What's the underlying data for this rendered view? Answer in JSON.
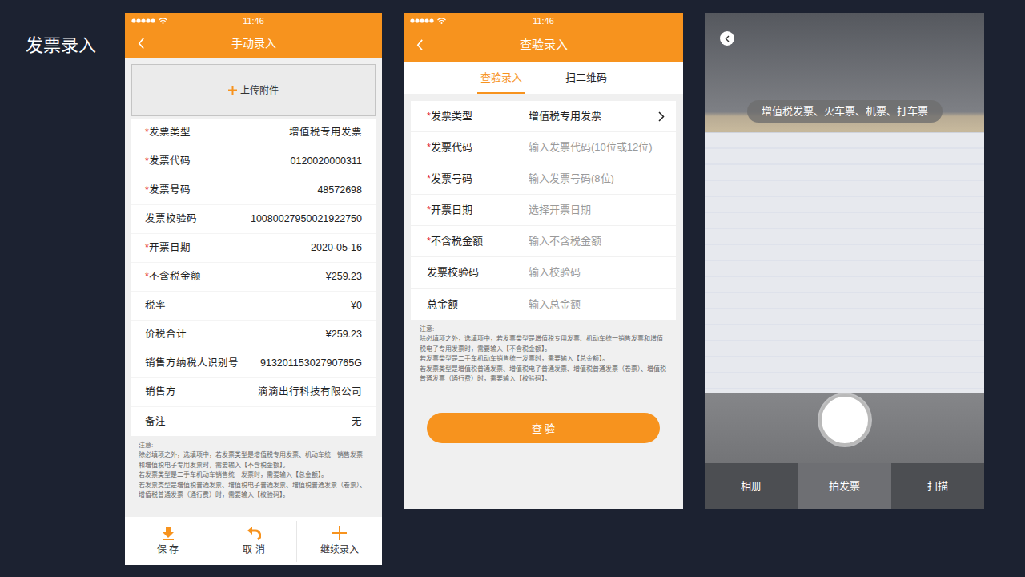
{
  "page": {
    "title": "发票录入"
  },
  "manual": {
    "time": "11:46",
    "title": "手动录入",
    "upload": "上传附件",
    "fields": [
      {
        "mark": "*",
        "label": "发票类型",
        "value": "增值税专用发票"
      },
      {
        "mark": "*",
        "label": "发票代码",
        "value": "0120020000311"
      },
      {
        "mark": "*",
        "label": "发票号码",
        "value": "48572698"
      },
      {
        "label": "发票校验码",
        "value": "10080027950021922750"
      },
      {
        "mark": "*",
        "label": "开票日期",
        "value": "2020-05-16"
      },
      {
        "mark": "*",
        "label": "不含税金额",
        "value": "¥259.23"
      },
      {
        "label": "税率",
        "value": "¥0"
      },
      {
        "label": "价税合计",
        "value": "¥259.23"
      },
      {
        "label": "销售方纳税人识别号",
        "value": "91320115302790765G"
      },
      {
        "label": "销售方",
        "value": "滴滴出行科技有限公司"
      },
      {
        "label": "备注",
        "value": "无"
      }
    ],
    "note_title": "注意:",
    "notes": [
      "除必填项之外，选填项中，若发票类型是增值税专用发票、机动车统一销售发票和增值税电子专用发票时，需要输入【不含税金额】。",
      "若发票类型是二手车机动车销售统一发票时，需要输入【总金额】。",
      "若发票类型是增值税普通发票、增值税电子普通发票、增值税普通发票（卷票）、增值税普通发票（通行费）时，需要输入【校验码】。"
    ],
    "actions": [
      {
        "label": "保 存",
        "kind": "save"
      },
      {
        "label": "取 消",
        "kind": "cancel"
      },
      {
        "label": "继续录入",
        "kind": "add"
      }
    ]
  },
  "check": {
    "time": "11:46",
    "title": "查验录入",
    "tabs": [
      {
        "label": "查验录入",
        "selected": true
      },
      {
        "label": "扫二维码",
        "selected": false
      }
    ],
    "fields": [
      {
        "mark": "*",
        "label": "发票类型",
        "kind": "select",
        "value": "增值税专用发票"
      },
      {
        "mark": "*",
        "label": "发票代码",
        "kind": "input",
        "placeholder": "输入发票代码(10位或12位)"
      },
      {
        "mark": "*",
        "label": "发票号码",
        "kind": "input",
        "placeholder": "输入发票号码(8位)"
      },
      {
        "mark": "*",
        "label": "开票日期",
        "kind": "input",
        "placeholder": "选择开票日期"
      },
      {
        "mark": "*",
        "label": "不含税金额",
        "kind": "input",
        "placeholder": "输入不含税金额"
      },
      {
        "label": "发票校验码",
        "kind": "input",
        "placeholder": "输入校验码"
      },
      {
        "label": "总金额",
        "kind": "input",
        "placeholder": "输入总金额"
      }
    ],
    "note_title": "注意:",
    "notes": [
      "除必填项之外，选填项中，若发票类型是增值税专用发票、机动车统一销售发票和增值税电子专用发票时，需要输入【不含税金额】。",
      "若发票类型是二手车机动车销售统一发票时，需要输入【总金额】。",
      "若发票类型是增值税普通发票、增值税电子普通发票、增值税普通发票（卷票）、增值税普通发票（通行费）时，需要输入【校验码】。"
    ],
    "button": "查 验"
  },
  "camera": {
    "hint": "增值税发票、火车票、机票、打车票",
    "modes": [
      {
        "label": "相册",
        "selected": false
      },
      {
        "label": "拍发票",
        "selected": true
      },
      {
        "label": "扫描",
        "selected": false
      }
    ]
  }
}
